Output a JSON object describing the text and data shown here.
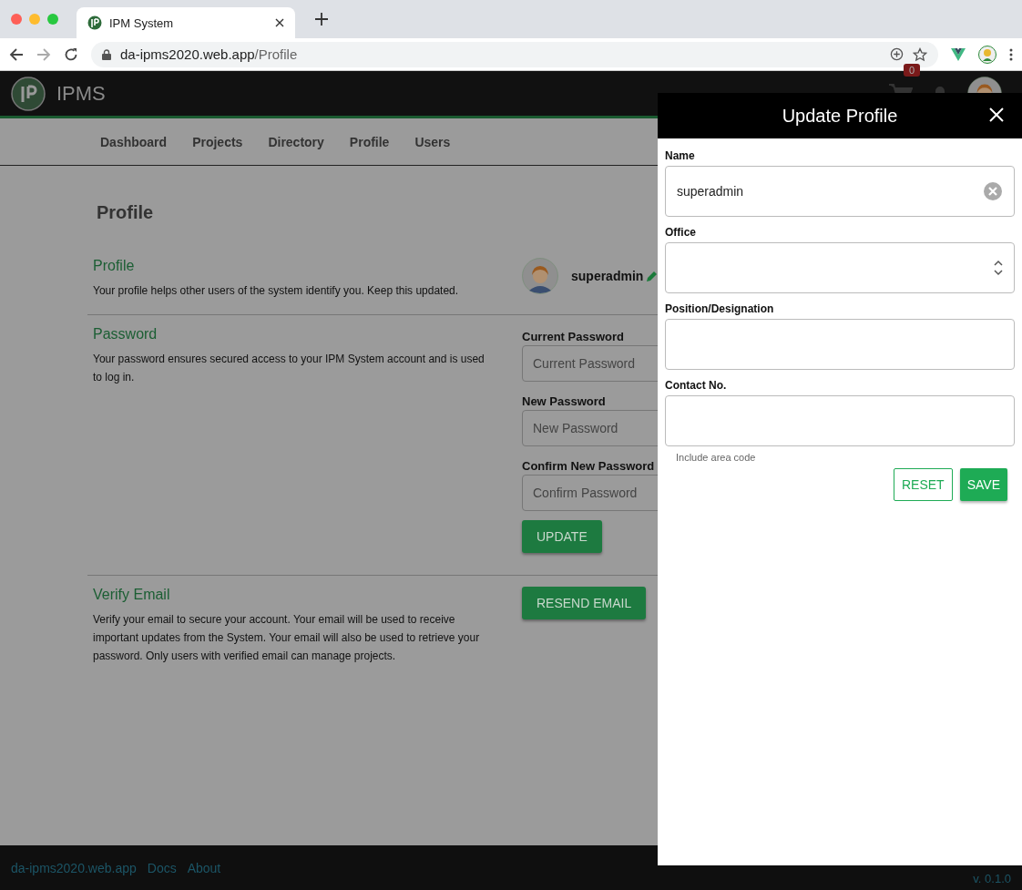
{
  "browser": {
    "tab_title": "IPM System",
    "url_host": "da-ipms2020.web.app",
    "url_path": "/Profile"
  },
  "header": {
    "brand": "IPMS",
    "cart_count": "0"
  },
  "nav": [
    "Dashboard",
    "Projects",
    "Directory",
    "Profile",
    "Users"
  ],
  "page_title": "Profile",
  "profile": {
    "heading": "Profile",
    "text": "Your profile helps other users of the system identify you. Keep this updated.",
    "username": "superadmin"
  },
  "password": {
    "heading": "Password",
    "text": "Your password ensures secured access to your IPM System account and is used to log in.",
    "fields": [
      {
        "label": "Current Password",
        "placeholder": "Current Password"
      },
      {
        "label": "New Password",
        "placeholder": "New Password"
      },
      {
        "label": "Confirm New Password",
        "placeholder": "Confirm Password"
      }
    ],
    "button": "UPDATE"
  },
  "verify": {
    "heading": "Verify Email",
    "text": "Verify your email to secure your account. Your email will be used to receive important updates from the System. Your email will also be used to retrieve your password. Only users with verified email can manage projects.",
    "button": "RESEND EMAIL"
  },
  "footer": {
    "links": [
      "da-ipms2020.web.app",
      "Docs",
      "About"
    ],
    "version": "v. 0.1.0"
  },
  "drawer": {
    "title": "Update Profile",
    "fields": [
      {
        "label": "Name",
        "kind": "text",
        "value": "superadmin"
      },
      {
        "label": "Office",
        "kind": "select"
      },
      {
        "label": "Position/Designation",
        "kind": "text"
      },
      {
        "label": "Contact No.",
        "kind": "text",
        "hint": "Include area code"
      }
    ],
    "buttons": [
      {
        "label": "RESET",
        "kind": "outline"
      },
      {
        "label": "SAVE",
        "kind": "filled"
      }
    ]
  }
}
